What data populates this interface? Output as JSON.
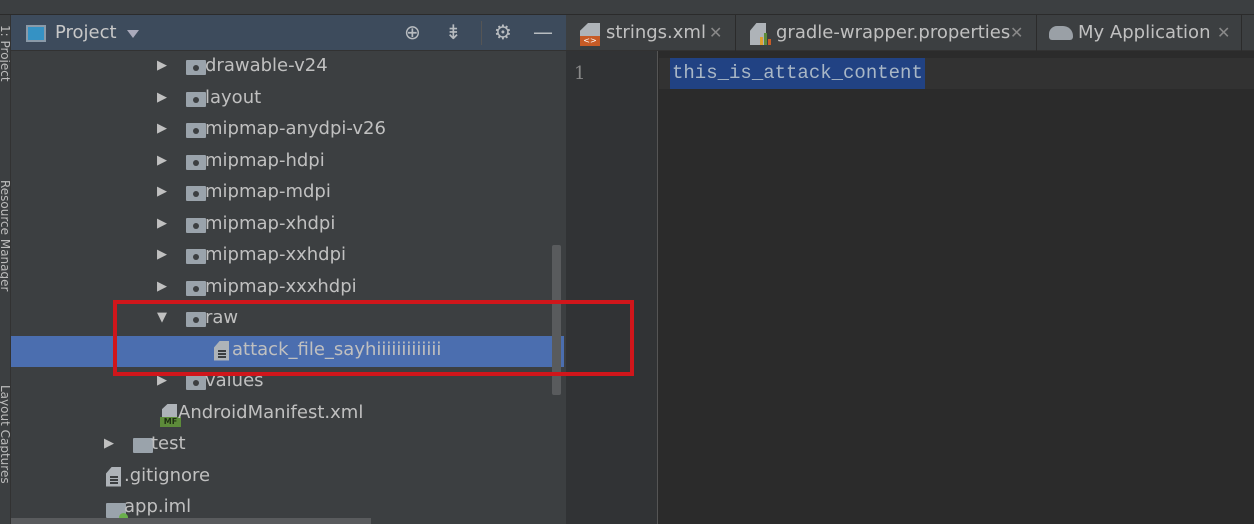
{
  "side_strip": [
    "1: Project",
    "Resource Manager",
    "Layout Captures"
  ],
  "project_panel": {
    "title": "Project",
    "icons": [
      "locate-icon",
      "collapse-all-icon",
      "gear-icon",
      "minimize-icon"
    ]
  },
  "tree": [
    {
      "label": "drawable-v24",
      "type": "res-folder",
      "expanded": false
    },
    {
      "label": "layout",
      "type": "res-folder",
      "expanded": false
    },
    {
      "label": "mipmap-anydpi-v26",
      "type": "res-folder",
      "expanded": false
    },
    {
      "label": "mipmap-hdpi",
      "type": "res-folder",
      "expanded": false
    },
    {
      "label": "mipmap-mdpi",
      "type": "res-folder",
      "expanded": false
    },
    {
      "label": "mipmap-xhdpi",
      "type": "res-folder",
      "expanded": false
    },
    {
      "label": "mipmap-xxhdpi",
      "type": "res-folder",
      "expanded": false
    },
    {
      "label": "mipmap-xxxhdpi",
      "type": "res-folder",
      "expanded": false
    },
    {
      "label": "raw",
      "type": "res-folder",
      "expanded": true
    },
    {
      "label": "attack_file_sayhiiiiiiiiiiiii",
      "type": "text-file",
      "selected": true
    },
    {
      "label": "values",
      "type": "res-folder",
      "expanded": false
    },
    {
      "label": "AndroidManifest.xml",
      "type": "manifest",
      "badge": "MF"
    },
    {
      "label": "test",
      "type": "folder",
      "expanded": false
    },
    {
      "label": ".gitignore",
      "type": "text-file"
    },
    {
      "label": "app.iml",
      "type": "module-file"
    }
  ],
  "tabs": [
    {
      "label": "strings.xml",
      "icon": "xml-file-icon"
    },
    {
      "label": "gradle-wrapper.properties",
      "icon": "properties-file-icon"
    },
    {
      "label": "My Application",
      "icon": "gradle-elephant-icon"
    }
  ],
  "editor": {
    "line_number": "1",
    "content": "this_is_attack_content"
  },
  "colors": {
    "selection": "#4b6eaf",
    "highlight_box": "#d0161b",
    "text_selection": "#214283"
  }
}
